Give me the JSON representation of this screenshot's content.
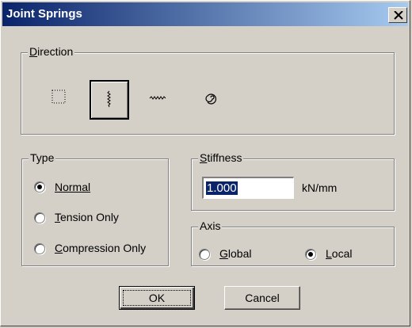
{
  "window": {
    "title": "Joint Springs"
  },
  "direction": {
    "label": "Direction",
    "options": [
      {
        "icon": "translational-none-icon",
        "selected": false
      },
      {
        "icon": "vertical-spring-icon",
        "selected": true
      },
      {
        "icon": "horizontal-spring-icon",
        "selected": false
      },
      {
        "icon": "rotational-spring-icon",
        "selected": false
      }
    ]
  },
  "type": {
    "label": "Type",
    "options": [
      {
        "label": "Normal",
        "selected": true
      },
      {
        "label": "Tension Only",
        "selected": false
      },
      {
        "label": "Compression Only",
        "selected": false
      }
    ]
  },
  "stiffness": {
    "label": "Stiffness",
    "value": "1.000",
    "unit": "kN/mm"
  },
  "axis": {
    "label": "Axis",
    "options": [
      {
        "label": "Global",
        "selected": false
      },
      {
        "label": "Local",
        "selected": true
      }
    ]
  },
  "buttons": {
    "ok": "OK",
    "cancel": "Cancel"
  },
  "colors": {
    "face": "#d4d0c8",
    "title_start": "#0a246a",
    "title_end": "#a6caf0",
    "selection": "#0a246a"
  }
}
